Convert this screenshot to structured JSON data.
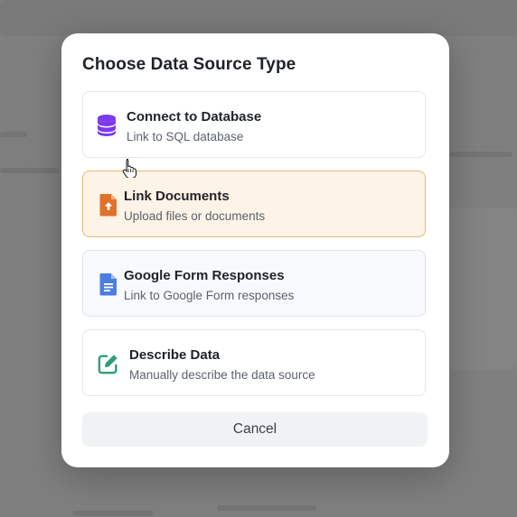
{
  "dialog": {
    "title": "Choose Data Source Type",
    "options": [
      {
        "title": "Connect to Database",
        "subtitle": "Link to SQL database",
        "icon": "database-icon",
        "icon_color": "#7c3aed",
        "state": "default"
      },
      {
        "title": "Link Documents",
        "subtitle": "Upload files or documents",
        "icon": "document-upload-icon",
        "icon_color": "#e0702a",
        "state": "hovered"
      },
      {
        "title": "Google Form Responses",
        "subtitle": "Link to Google Form responses",
        "icon": "google-docs-icon",
        "icon_color": "#4a7ee0",
        "state": "default"
      },
      {
        "title": "Describe Data",
        "subtitle": "Manually describe the data source",
        "icon": "edit-pencil-icon",
        "icon_color": "#2f9e7a",
        "state": "default"
      }
    ],
    "cancel_label": "Cancel"
  },
  "colors": {
    "selected_background": "#fdf3e6",
    "selected_border": "#e8b778",
    "backdrop": "#7d7d7d"
  }
}
